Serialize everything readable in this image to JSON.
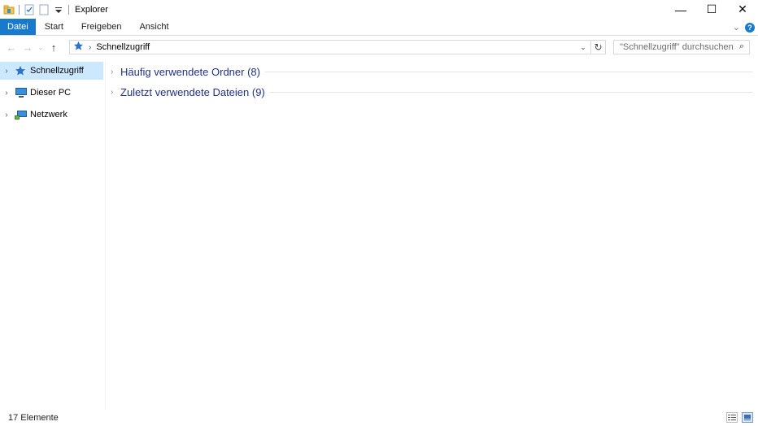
{
  "window": {
    "title": "Explorer",
    "minimize_glyph": "—",
    "maximize_glyph": "☐",
    "close_glyph": "✕"
  },
  "ribbon": {
    "tabs": [
      {
        "label": "Datei"
      },
      {
        "label": "Start"
      },
      {
        "label": "Freigeben"
      },
      {
        "label": "Ansicht"
      }
    ],
    "collapse_glyph": "⌄",
    "help_glyph": "?"
  },
  "address": {
    "back_glyph": "←",
    "forward_glyph": "→",
    "recent_glyph": "⌄",
    "up_glyph": "↑",
    "breadcrumb_sep": "›",
    "location": "Schnellzugriff",
    "dropdown_glyph": "⌄",
    "refresh_glyph": "↻"
  },
  "search": {
    "placeholder": "\"Schnellzugriff\" durchsuchen",
    "icon_glyph": "⌕"
  },
  "navigation": {
    "items": [
      {
        "label": "Schnellzugriff",
        "icon": "quick-access-star-icon",
        "selected": true
      },
      {
        "label": "Dieser PC",
        "icon": "computer-icon",
        "selected": false
      },
      {
        "label": "Netzwerk",
        "icon": "network-icon",
        "selected": false
      }
    ],
    "expander_glyph": "›"
  },
  "content": {
    "groups": [
      {
        "label": "Häufig verwendete Ordner (8)"
      },
      {
        "label": "Zuletzt verwendete Dateien (9)"
      }
    ],
    "expander_glyph": "›"
  },
  "status": {
    "item_count": "17 Elemente"
  },
  "colors": {
    "accent": "#1979ca",
    "selection": "#cce8ff",
    "group_heading": "#1e3287"
  }
}
